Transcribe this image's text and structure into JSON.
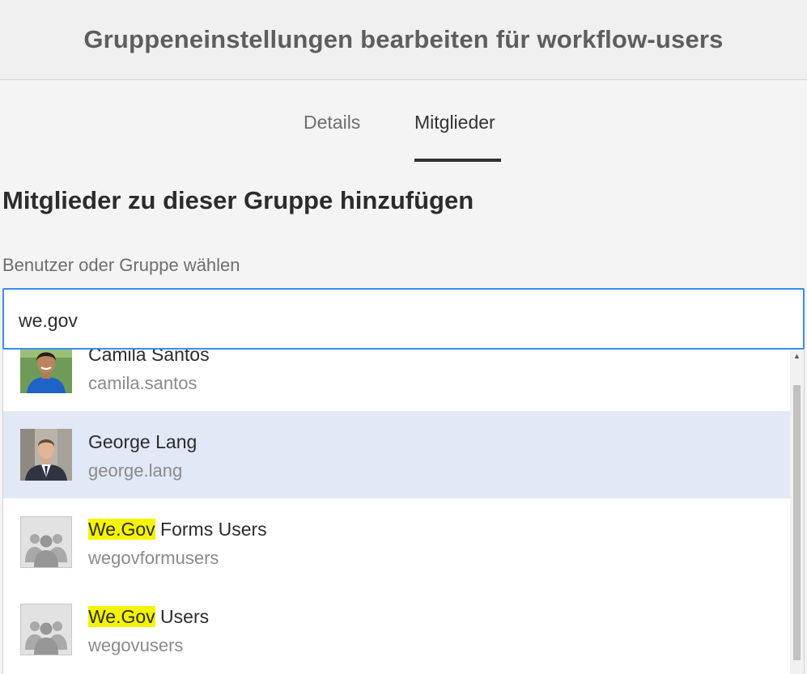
{
  "header": {
    "title": "Gruppeneinstellungen bearbeiten für workflow-users"
  },
  "tabs": [
    {
      "label": "Details",
      "active": false
    },
    {
      "label": "Mitglieder",
      "active": true
    }
  ],
  "section": {
    "title": "Mitglieder zu dieser Gruppe hinzufügen",
    "field_label": "Benutzer oder Gruppe wählen"
  },
  "search": {
    "value": "we.gov"
  },
  "results": [
    {
      "name": "Camila Santos",
      "id": "camila.santos",
      "type": "user",
      "avatar": "photo-icon-woman"
    },
    {
      "name": "George Lang",
      "id": "george.lang",
      "type": "user",
      "avatar": "photo-icon-man",
      "selected": true
    },
    {
      "highlight": "We.Gov",
      "name_rest": " Forms Users",
      "id": "wegovformusers",
      "type": "group",
      "avatar": "group-icon"
    },
    {
      "highlight": "We.Gov",
      "name_rest": " Users",
      "id": "wegovusers",
      "type": "group",
      "avatar": "group-icon"
    }
  ],
  "colors": {
    "accent": "#378ef0",
    "selected_row": "#e1e9f6",
    "highlight": "#f4f400"
  }
}
